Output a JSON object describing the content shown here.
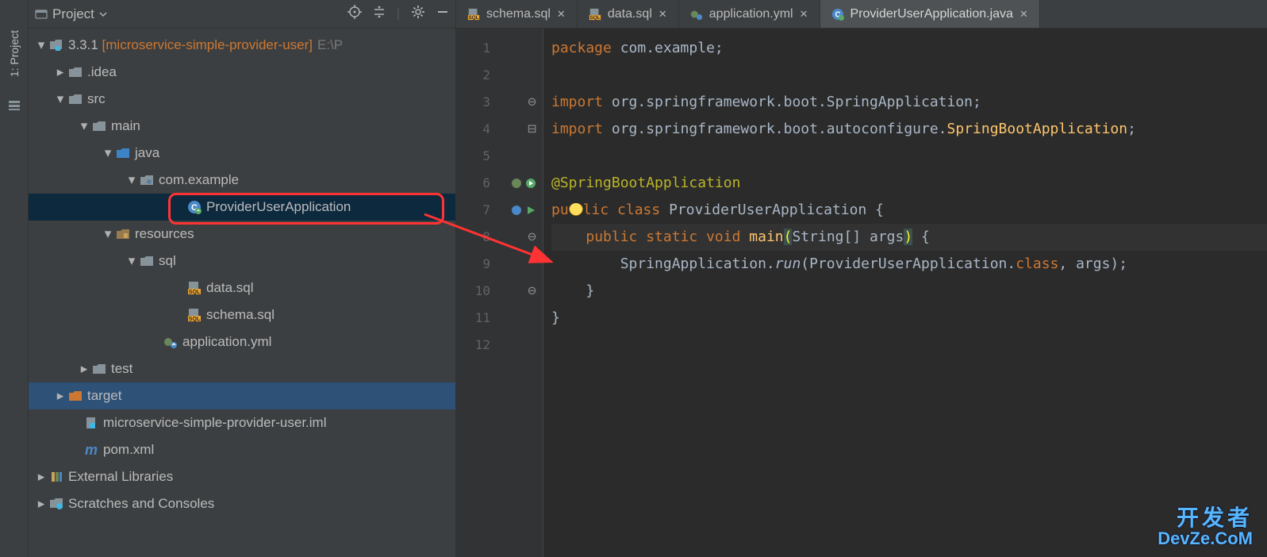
{
  "sidebar": {
    "label": "1: Project"
  },
  "panel": {
    "title": "Project",
    "root": {
      "name": "3.3.1",
      "module": "[microservice-simple-provider-user]",
      "path": "E:\\P"
    },
    "tree": {
      "idea": ".idea",
      "src": "src",
      "main": "main",
      "java": "java",
      "pkg": "com.example",
      "app_class": "ProviderUserApplication",
      "resources": "resources",
      "sql": "sql",
      "data_sql": "data.sql",
      "schema_sql": "schema.sql",
      "app_yml": "application.yml",
      "test": "test",
      "target": "target",
      "iml": "microservice-simple-provider-user.iml",
      "pom": "pom.xml",
      "ext_libs": "External Libraries",
      "scratches": "Scratches and Consoles"
    }
  },
  "tabs": [
    {
      "label": "schema.sql",
      "active": false
    },
    {
      "label": "data.sql",
      "active": false
    },
    {
      "label": "application.yml",
      "active": false
    },
    {
      "label": "ProviderUserApplication.java",
      "active": true
    }
  ],
  "code": {
    "l1_a": "package",
    "l1_b": " com.example;",
    "l3_a": "import",
    "l3_b": " org.springframework.boot.SpringApplication;",
    "l4_a": "import",
    "l4_b": " org.springframework.boot.autoconfigure.",
    "l4_c": "SpringBootApplication",
    "l4_d": ";",
    "l6": "@SpringBootApplication",
    "l7_a": "pu",
    "l7_b": "lic ",
    "l7_c": "class",
    "l7_d": " ProviderUserApplication {",
    "l8_a": "    ",
    "l8_b": "public static ",
    "l8_c": "void ",
    "l8_d": "main",
    "l8_e": "(",
    "l8_f": "String[] args",
    "l8_g": ")",
    "l8_h": " {",
    "l9_a": "        SpringApplication.",
    "l9_b": "run",
    "l9_c": "(ProviderUserApplication.",
    "l9_d": "class",
    "l9_e": ", args);",
    "l10": "    }",
    "l11": "}"
  },
  "line_numbers": [
    "1",
    "2",
    "3",
    "4",
    "5",
    "6",
    "7",
    "8",
    "9",
    "10",
    "11",
    "12"
  ],
  "watermark": {
    "cn": "开发者",
    "en": "DevZe.CoM"
  }
}
